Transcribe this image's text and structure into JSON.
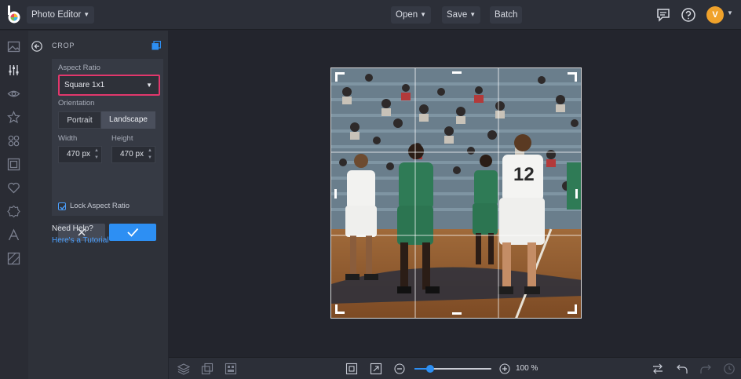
{
  "header": {
    "app_name": "Photo Editor",
    "menu": [
      "Open",
      "Save",
      "Batch"
    ],
    "avatar_initial": "V"
  },
  "rail": {
    "icons": [
      "image-icon",
      "sliders-icon",
      "eye-icon",
      "star-icon",
      "shapes-icon",
      "frame-icon",
      "heart-icon",
      "sticker-icon",
      "text-icon",
      "texture-icon"
    ]
  },
  "panel": {
    "title": "CROP",
    "aspect_ratio_label": "Aspect Ratio",
    "aspect_ratio_value": "Square 1x1",
    "orientation_label": "Orientation",
    "orientation_options": [
      "Portrait",
      "Landscape"
    ],
    "orientation_selected": "Landscape",
    "width_label": "Width",
    "height_label": "Height",
    "width_value": "470",
    "height_value": "470",
    "unit": "px",
    "lock_label": "Lock Aspect Ratio",
    "lock_checked": true,
    "help_title": "Need Help?",
    "help_link": "Here's a Tutorial"
  },
  "bottom": {
    "zoom_label": "100 %",
    "zoom_fraction": 0.2
  },
  "colors": {
    "accent": "#2d8ff3",
    "highlight": "#e2376c",
    "avatar": "#f0a22b"
  }
}
